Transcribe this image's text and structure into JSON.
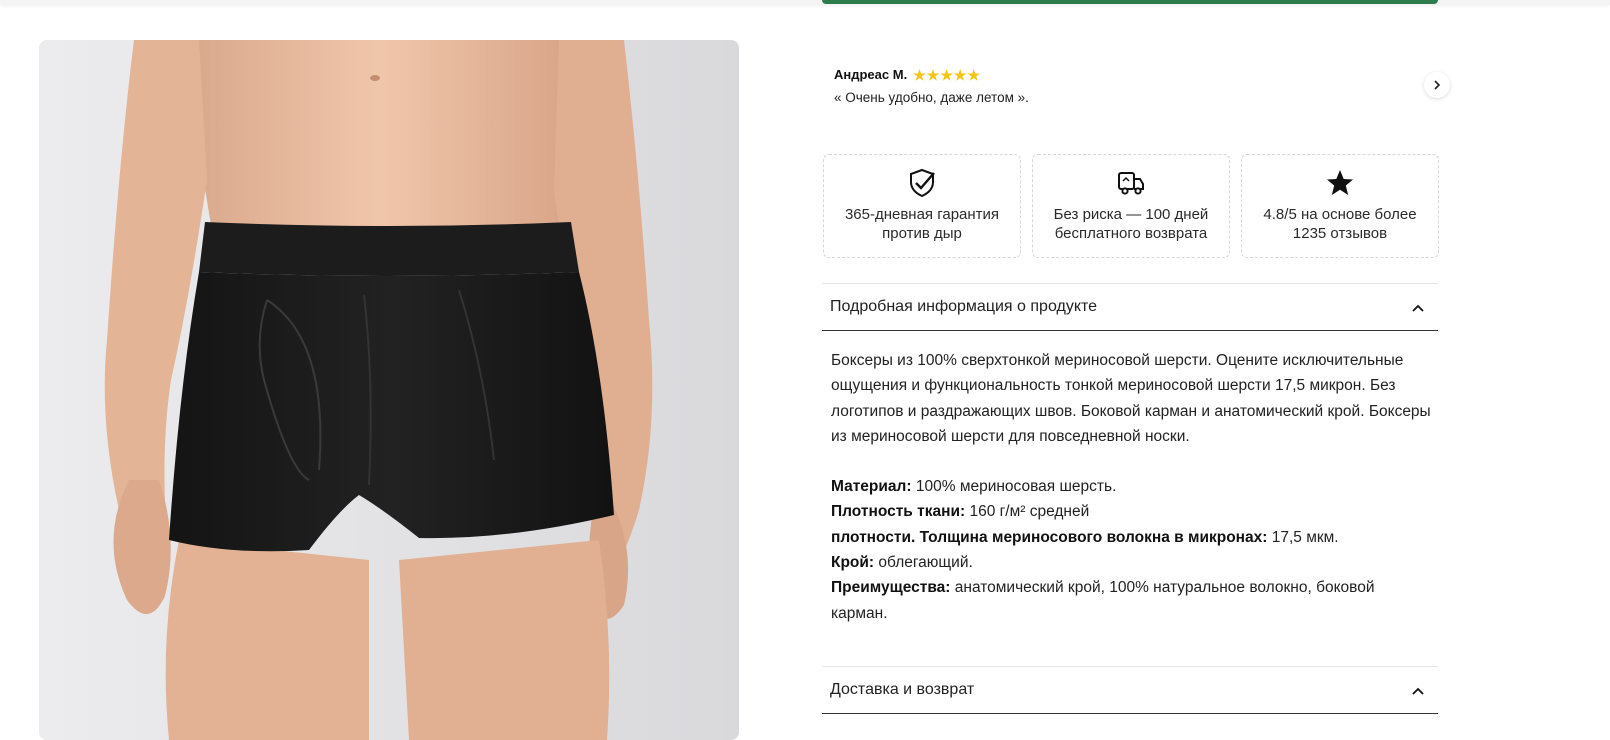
{
  "review": {
    "author": "Андреас М.",
    "rating": 5,
    "text": "« Очень удобно, даже летом ».",
    "next_icon": "chevron-right-icon"
  },
  "features": [
    {
      "icon": "shield-check-icon",
      "text": "365-дневная гарантия\nпротив дыр"
    },
    {
      "icon": "delivery-truck-icon",
      "text": "Без риска — 100 дней\nбесплатного возврата"
    },
    {
      "icon": "star-icon",
      "text": "4.8/5 на основе более\n1235 отзывов"
    }
  ],
  "accordion": {
    "details_title": "Подробная информация о продукте",
    "delivery_title": "Доставка и возврат"
  },
  "details": {
    "description": "Боксеры из 100% сверхтонкой мериносовой шерсти. Оцените исключительные ощущения и функциональность тонкой мериносовой шерсти 17,5 микрон. Без логотипов и раздражающих швов. Боковой карман и анатомический крой. Боксеры из мериносовой шерсти для повседневной носки.",
    "material_label": "Материал:",
    "material_value": " 100% мериносовая шерсть.",
    "density_label": "Плотность ткани:",
    "density_value": " 160 г/м² средней",
    "fiber_label": "плотности. Толщина мериносового волокна в микронах:",
    "fiber_value": " 17,5 мкм.",
    "cut_label": "Крой:",
    "cut_value": " облегающий.",
    "benefits_label": "Преимущества:",
    "benefits_value": " анатомический крой, 100% натуральное волокно, боковой карман."
  },
  "colors": {
    "accent": "#2f7d4f",
    "star": "#f5c518"
  }
}
